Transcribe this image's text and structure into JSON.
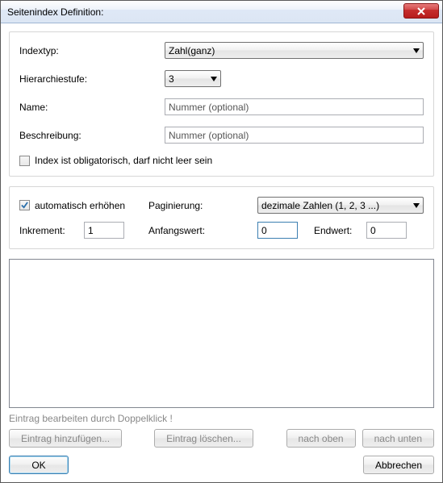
{
  "window": {
    "title": "Seitenindex Definition:"
  },
  "group1": {
    "indextyp_label": "Indextyp:",
    "indextyp_value": "Zahl(ganz)",
    "hierarchie_label": "Hierarchiestufe:",
    "hierarchie_value": "3",
    "name_label": "Name:",
    "name_placeholder": "Nummer (optional)",
    "beschreibung_label": "Beschreibung:",
    "beschreibung_placeholder": "Nummer (optional)",
    "obligatorisch_label": "Index ist obligatorisch, darf nicht leer sein",
    "obligatorisch_checked": false
  },
  "group2": {
    "auto_label": "automatisch erhöhen",
    "auto_checked": true,
    "paginierung_label": "Paginierung:",
    "paginierung_value": "dezimale Zahlen (1, 2, 3 ...)",
    "inkrement_label": "Inkrement:",
    "inkrement_value": "1",
    "anfangswert_label": "Anfangswert:",
    "anfangswert_value": "0",
    "endwert_label": "Endwert:",
    "endwert_value": "0"
  },
  "list": {
    "hint": "Eintrag bearbeiten durch Doppelklick !",
    "add_label": "Eintrag hinzufügen...",
    "delete_label": "Eintrag löschen...",
    "up_label": "nach oben",
    "down_label": "nach unten"
  },
  "footer": {
    "ok_label": "OK",
    "cancel_label": "Abbrechen"
  }
}
